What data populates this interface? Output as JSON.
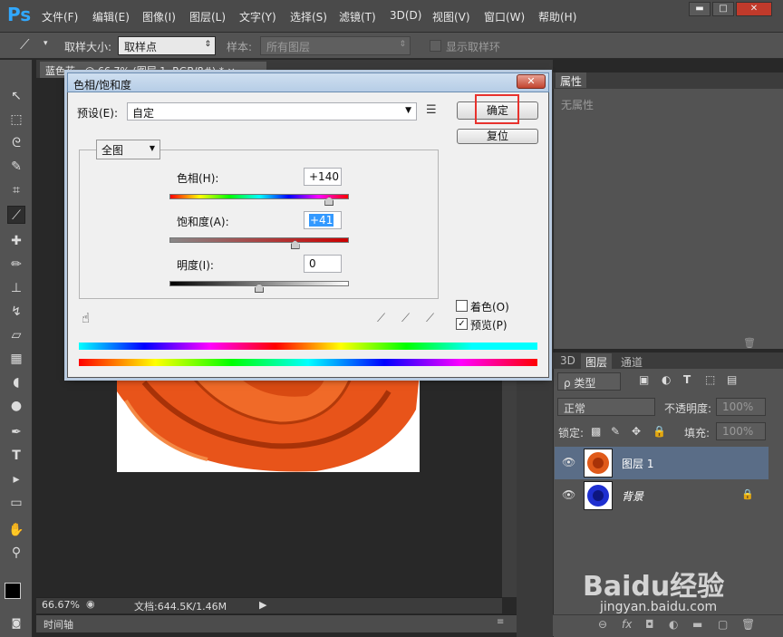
{
  "app": {
    "logo": "Ps"
  },
  "menu": [
    "文件(F)",
    "编辑(E)",
    "图像(I)",
    "图层(L)",
    "文字(Y)",
    "选择(S)",
    "滤镜(T)",
    "3D(D)",
    "视图(V)",
    "窗口(W)",
    "帮助(H)"
  ],
  "window_buttons": {
    "minimize": "▬",
    "restore": "□",
    "close": "✕"
  },
  "options_bar": {
    "sample_size_label": "取样大小:",
    "sample_size_value": "取样点",
    "sample_label": "样本:",
    "sample_value": "所有图层",
    "show_ring_label": "显示取样环"
  },
  "document": {
    "tab_title": "蓝色花...@ 66.7% (图层 1, RGB/8#) * ×",
    "zoom": "66.67%",
    "doc_info": "文档:644.5K/1.46M",
    "timeline_label": "时间轴"
  },
  "dialog": {
    "title": "色相/饱和度",
    "preset_label": "预设(E):",
    "preset_value": "自定",
    "channel_value": "全图",
    "hue_label": "色相(H):",
    "hue_value": "+140",
    "saturation_label": "饱和度(A):",
    "saturation_value": "+41",
    "lightness_label": "明度(I):",
    "lightness_value": "0",
    "ok_label": "确定",
    "reset_label": "复位",
    "colorize_label": "着色(O)",
    "preview_label": "预览(P)",
    "close_glyph": "✕",
    "hue_level": 0.89,
    "saturation_level": 0.7,
    "lightness_level": 0.5,
    "colorize_checked": false,
    "preview_checked": true,
    "highlight_color": "#e8322d"
  },
  "properties_panel": {
    "tab": "属性",
    "content": "无属性"
  },
  "layers_panel": {
    "tabs": [
      "3D",
      "图层",
      "通道"
    ],
    "filter_label": "ρ 类型",
    "blend_mode": "正常",
    "opacity_label": "不透明度:",
    "opacity_value": "100%",
    "lock_label": "锁定:",
    "fill_label": "填充:",
    "fill_value": "100%",
    "layers": [
      {
        "name": "图层 1",
        "thumb_color": "#e05a1a",
        "selected": true
      },
      {
        "name": "背景",
        "thumb_color": "#1e2fd0",
        "selected": false
      }
    ]
  },
  "watermark": {
    "text": "Baidu经验",
    "url": "jingyan.baidu.com"
  }
}
